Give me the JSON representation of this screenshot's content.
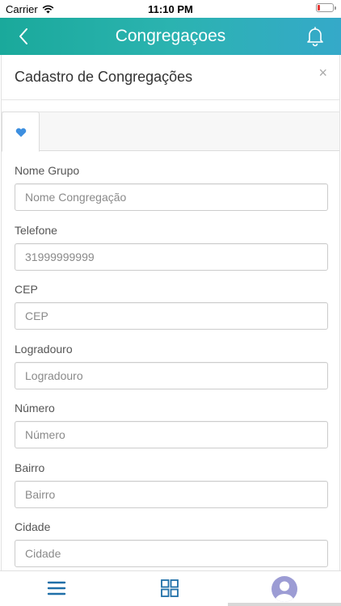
{
  "status_bar": {
    "carrier": "Carrier",
    "time": "11:10 PM"
  },
  "navbar": {
    "title": "Congregaçoes"
  },
  "modal": {
    "title": "Cadastro de Congregações",
    "close": "×"
  },
  "form": {
    "fields": [
      {
        "label": "Nome Grupo",
        "value": "",
        "placeholder": "Nome Congregação"
      },
      {
        "label": "Telefone",
        "value": "",
        "placeholder": "31999999999"
      },
      {
        "label": "CEP",
        "value": "",
        "placeholder": "CEP"
      },
      {
        "label": "Logradouro",
        "value": "",
        "placeholder": "Logradouro"
      },
      {
        "label": "Número",
        "value": "",
        "placeholder": "Número"
      },
      {
        "label": "Bairro",
        "value": "",
        "placeholder": "Bairro"
      },
      {
        "label": "Cidade",
        "value": "",
        "placeholder": "Cidade"
      }
    ]
  },
  "icons": {
    "back": "chevron-left-icon",
    "notifications": "bell-icon",
    "tab": "heart-icon",
    "menu": "hamburger-menu-icon",
    "apps": "grid-icon",
    "profile": "user-avatar-icon"
  },
  "colors": {
    "navbar_start": "#1aa99b",
    "navbar_end": "#35a9c9",
    "heart": "#3d8fe0",
    "bottom_icons": "#1f6fa8",
    "avatar_bg": "#9c9cd4",
    "battery_low": "#e53935"
  }
}
